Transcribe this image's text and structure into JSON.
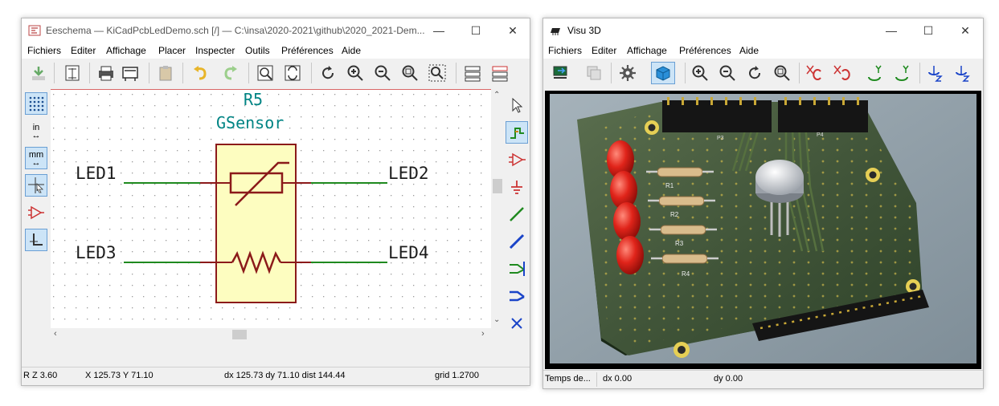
{
  "eeschema": {
    "title": "Eeschema — KiCadPcbLedDemo.sch [/] — C:\\insa\\2020-2021\\github\\2020_2021-Dem...",
    "menu": [
      "Fichiers",
      "Editer",
      "Affichage",
      "Placer",
      "Inspecter",
      "Outils",
      "Préférences",
      "Aide"
    ],
    "left_tools": {
      "units_in": "in",
      "units_mm": "mm"
    },
    "schematic": {
      "ref": "R5",
      "value": "GSensor",
      "net_led1": "LED1",
      "net_led2": "LED2",
      "net_led3": "LED3",
      "net_led4": "LED4"
    },
    "status": {
      "zoom": "Z 3.60",
      "zoom_prefix": "R",
      "coords": "X 125.73  Y 71.10",
      "delta": "dx 125.73  dy 71.10  dist 144.44",
      "grid": "grid 1.2700"
    },
    "colors": {
      "wire": "#1f8a1f",
      "component": "#8b1a1a",
      "component_fill": "#fdfdc0",
      "text": "#1c1c1c",
      "field_text": "#008484"
    }
  },
  "visu3d": {
    "title": "Visu 3D",
    "menu": [
      "Fichiers",
      "Editer",
      "Affichage",
      "Préférences",
      "Aide"
    ],
    "board_labels": {
      "p3": "P3",
      "p4": "P4",
      "r1": "R1",
      "r2": "R2",
      "r3": "R3",
      "r4": "R4"
    },
    "status": {
      "left": "Temps de...",
      "dx": "dx 0.00",
      "dy": "dy 0.00"
    },
    "colors": {
      "pcb": "#3c5a34",
      "led": "#e0241a",
      "canvas_border": "#000000"
    }
  }
}
